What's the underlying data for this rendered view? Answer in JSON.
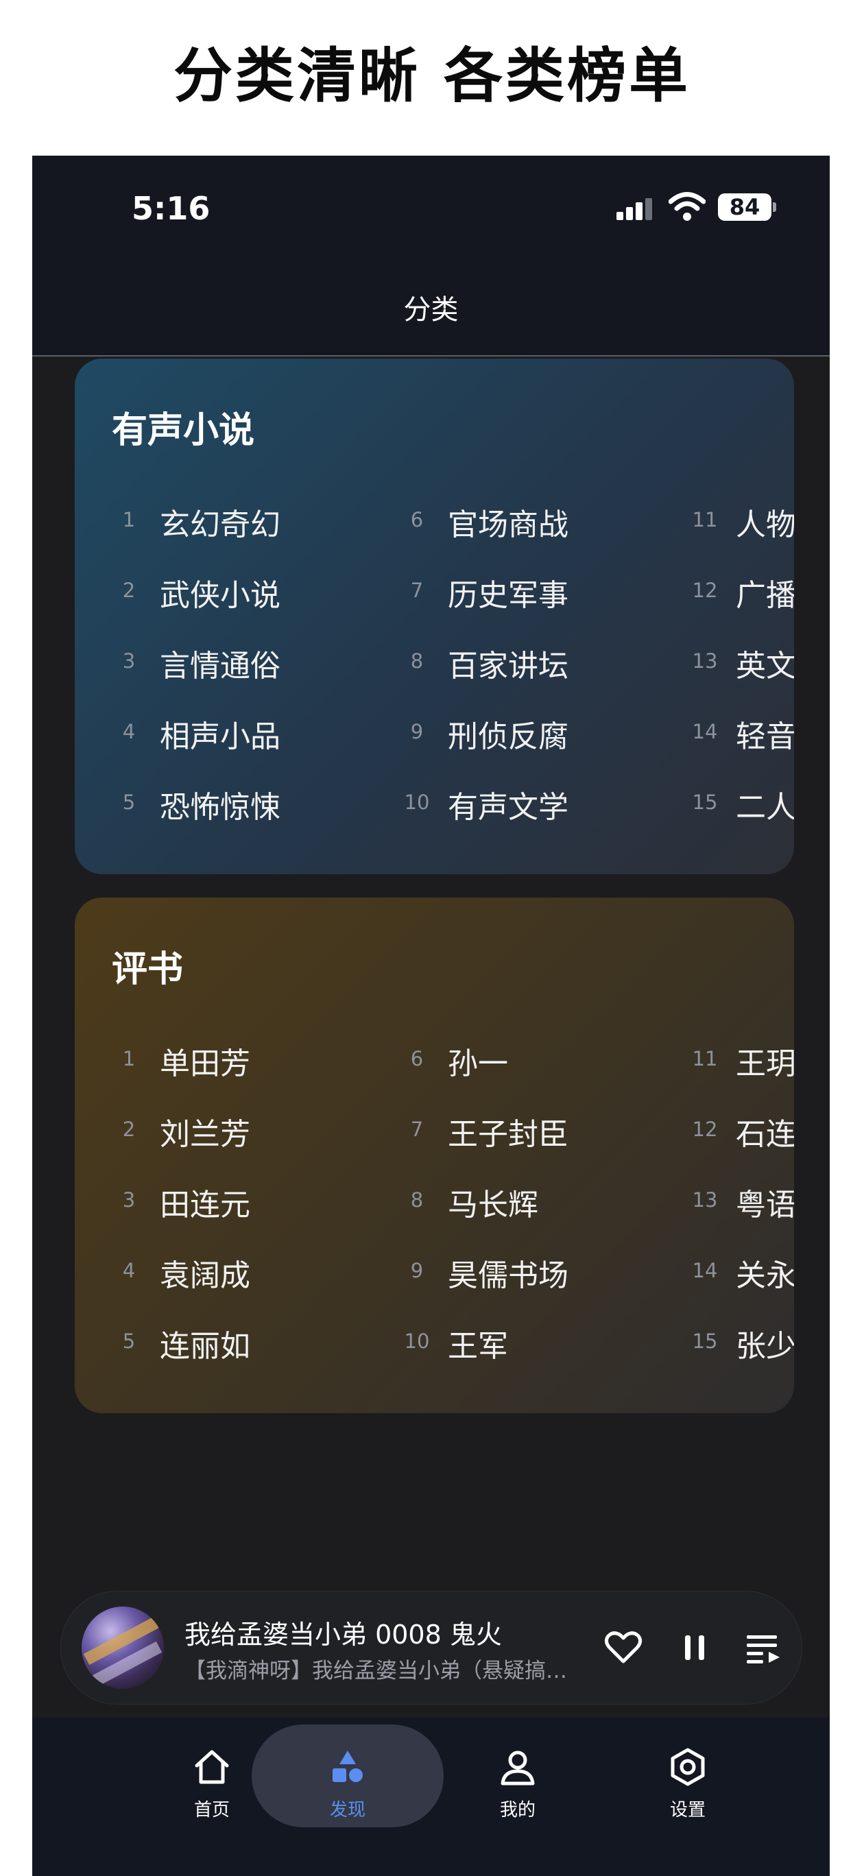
{
  "headline": "分类清晰 各类榜单",
  "status_bar": {
    "time": "5:16",
    "battery": "84"
  },
  "nav": {
    "title": "分类"
  },
  "categories": [
    {
      "title": "有声小说",
      "items": [
        {
          "num": "1",
          "label": "玄幻奇幻"
        },
        {
          "num": "2",
          "label": "武侠小说"
        },
        {
          "num": "3",
          "label": "言情通俗"
        },
        {
          "num": "4",
          "label": "相声小品"
        },
        {
          "num": "5",
          "label": "恐怖惊悚"
        },
        {
          "num": "6",
          "label": "官场商战"
        },
        {
          "num": "7",
          "label": "历史军事"
        },
        {
          "num": "8",
          "label": "百家讲坛"
        },
        {
          "num": "9",
          "label": "刑侦反腐"
        },
        {
          "num": "10",
          "label": "有声文学"
        },
        {
          "num": "11",
          "label": "人物"
        },
        {
          "num": "12",
          "label": "广播"
        },
        {
          "num": "13",
          "label": "英文"
        },
        {
          "num": "14",
          "label": "轻音"
        },
        {
          "num": "15",
          "label": "二人"
        }
      ]
    },
    {
      "title": "评书",
      "items": [
        {
          "num": "1",
          "label": "单田芳"
        },
        {
          "num": "2",
          "label": "刘兰芳"
        },
        {
          "num": "3",
          "label": "田连元"
        },
        {
          "num": "4",
          "label": "袁阔成"
        },
        {
          "num": "5",
          "label": "连丽如"
        },
        {
          "num": "6",
          "label": "孙一"
        },
        {
          "num": "7",
          "label": "王子封臣"
        },
        {
          "num": "8",
          "label": "马长辉"
        },
        {
          "num": "9",
          "label": "昊儒书场"
        },
        {
          "num": "10",
          "label": "王军"
        },
        {
          "num": "11",
          "label": "王玥"
        },
        {
          "num": "12",
          "label": "石连"
        },
        {
          "num": "13",
          "label": "粤语"
        },
        {
          "num": "14",
          "label": "关永"
        },
        {
          "num": "15",
          "label": "张少"
        }
      ]
    }
  ],
  "player": {
    "title": "我给孟婆当小弟 0008 鬼火",
    "subtitle": "【我滴神呀】我给孟婆当小弟（悬疑搞笑…",
    "controls": [
      "heart-icon",
      "pause-icon",
      "playlist-icon"
    ]
  },
  "tabs": [
    {
      "label": "首页",
      "icon": "home-icon"
    },
    {
      "label": "发现",
      "icon": "discover-icon",
      "active": true
    },
    {
      "label": "我的",
      "icon": "user-icon"
    },
    {
      "label": "设置",
      "icon": "settings-icon"
    }
  ],
  "colors": {
    "accent": "#5b8ef0",
    "background": "#1c1c1e",
    "card_blue": "#1f4a63",
    "card_gold": "#4d3b1a"
  }
}
